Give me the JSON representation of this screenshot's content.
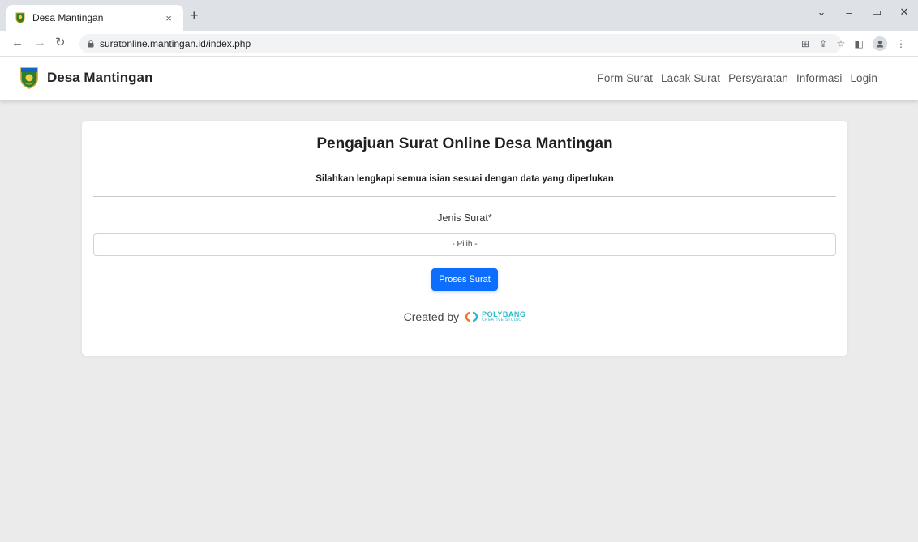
{
  "browser": {
    "tab_title": "Desa Mantingan",
    "tab_close": "×",
    "new_tab": "+",
    "url": "suratonline.mantingan.id/index.php",
    "window_controls": [
      "⌄",
      "–",
      "▭",
      "✕"
    ]
  },
  "navbar": {
    "brand": "Desa Mantingan",
    "links": [
      "Form Surat",
      "Lacak Surat",
      "Persyaratan",
      "Informasi",
      "Login"
    ]
  },
  "card": {
    "title": "Pengajuan Surat Online Desa Mantingan",
    "subtitle": "Silahkan lengkapi semua isian sesuai dengan data yang diperlukan",
    "field_label": "Jenis Surat*",
    "select_value": "- Pilih -",
    "submit_label": "Proses Surat",
    "credit_text": "Created by",
    "credit_brand": "POLYBANG",
    "credit_tagline": "CREATIVE STUDIO"
  },
  "colors": {
    "primary": "#0d6efd",
    "page_bg": "#ebebeb",
    "brand_accent": "#2bbcc8"
  }
}
